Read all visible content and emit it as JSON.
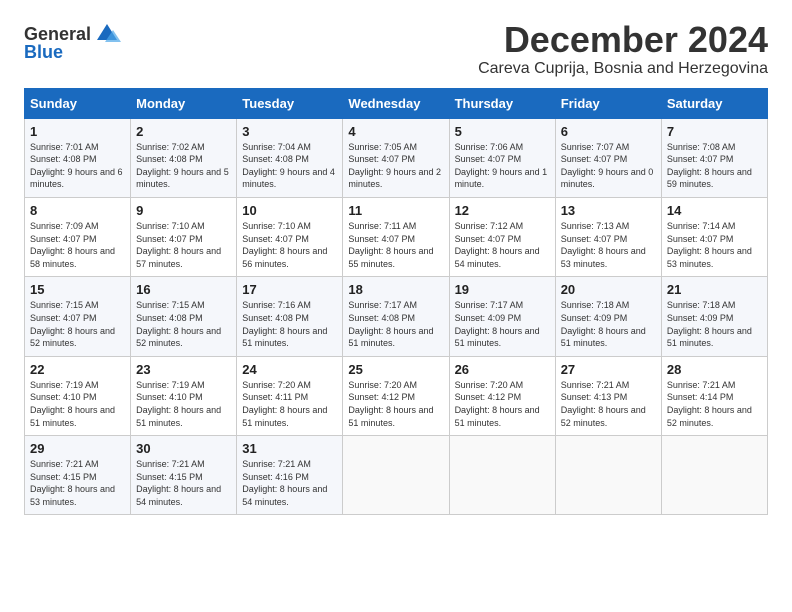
{
  "logo": {
    "general": "General",
    "blue": "Blue"
  },
  "title": "December 2024",
  "subtitle": "Careva Cuprija, Bosnia and Herzegovina",
  "days_header": [
    "Sunday",
    "Monday",
    "Tuesday",
    "Wednesday",
    "Thursday",
    "Friday",
    "Saturday"
  ],
  "weeks": [
    [
      {
        "day": "1",
        "sunrise": "Sunrise: 7:01 AM",
        "sunset": "Sunset: 4:08 PM",
        "daylight": "Daylight: 9 hours and 6 minutes."
      },
      {
        "day": "2",
        "sunrise": "Sunrise: 7:02 AM",
        "sunset": "Sunset: 4:08 PM",
        "daylight": "Daylight: 9 hours and 5 minutes."
      },
      {
        "day": "3",
        "sunrise": "Sunrise: 7:04 AM",
        "sunset": "Sunset: 4:08 PM",
        "daylight": "Daylight: 9 hours and 4 minutes."
      },
      {
        "day": "4",
        "sunrise": "Sunrise: 7:05 AM",
        "sunset": "Sunset: 4:07 PM",
        "daylight": "Daylight: 9 hours and 2 minutes."
      },
      {
        "day": "5",
        "sunrise": "Sunrise: 7:06 AM",
        "sunset": "Sunset: 4:07 PM",
        "daylight": "Daylight: 9 hours and 1 minute."
      },
      {
        "day": "6",
        "sunrise": "Sunrise: 7:07 AM",
        "sunset": "Sunset: 4:07 PM",
        "daylight": "Daylight: 9 hours and 0 minutes."
      },
      {
        "day": "7",
        "sunrise": "Sunrise: 7:08 AM",
        "sunset": "Sunset: 4:07 PM",
        "daylight": "Daylight: 8 hours and 59 minutes."
      }
    ],
    [
      {
        "day": "8",
        "sunrise": "Sunrise: 7:09 AM",
        "sunset": "Sunset: 4:07 PM",
        "daylight": "Daylight: 8 hours and 58 minutes."
      },
      {
        "day": "9",
        "sunrise": "Sunrise: 7:10 AM",
        "sunset": "Sunset: 4:07 PM",
        "daylight": "Daylight: 8 hours and 57 minutes."
      },
      {
        "day": "10",
        "sunrise": "Sunrise: 7:10 AM",
        "sunset": "Sunset: 4:07 PM",
        "daylight": "Daylight: 8 hours and 56 minutes."
      },
      {
        "day": "11",
        "sunrise": "Sunrise: 7:11 AM",
        "sunset": "Sunset: 4:07 PM",
        "daylight": "Daylight: 8 hours and 55 minutes."
      },
      {
        "day": "12",
        "sunrise": "Sunrise: 7:12 AM",
        "sunset": "Sunset: 4:07 PM",
        "daylight": "Daylight: 8 hours and 54 minutes."
      },
      {
        "day": "13",
        "sunrise": "Sunrise: 7:13 AM",
        "sunset": "Sunset: 4:07 PM",
        "daylight": "Daylight: 8 hours and 53 minutes."
      },
      {
        "day": "14",
        "sunrise": "Sunrise: 7:14 AM",
        "sunset": "Sunset: 4:07 PM",
        "daylight": "Daylight: 8 hours and 53 minutes."
      }
    ],
    [
      {
        "day": "15",
        "sunrise": "Sunrise: 7:15 AM",
        "sunset": "Sunset: 4:07 PM",
        "daylight": "Daylight: 8 hours and 52 minutes."
      },
      {
        "day": "16",
        "sunrise": "Sunrise: 7:15 AM",
        "sunset": "Sunset: 4:08 PM",
        "daylight": "Daylight: 8 hours and 52 minutes."
      },
      {
        "day": "17",
        "sunrise": "Sunrise: 7:16 AM",
        "sunset": "Sunset: 4:08 PM",
        "daylight": "Daylight: 8 hours and 51 minutes."
      },
      {
        "day": "18",
        "sunrise": "Sunrise: 7:17 AM",
        "sunset": "Sunset: 4:08 PM",
        "daylight": "Daylight: 8 hours and 51 minutes."
      },
      {
        "day": "19",
        "sunrise": "Sunrise: 7:17 AM",
        "sunset": "Sunset: 4:09 PM",
        "daylight": "Daylight: 8 hours and 51 minutes."
      },
      {
        "day": "20",
        "sunrise": "Sunrise: 7:18 AM",
        "sunset": "Sunset: 4:09 PM",
        "daylight": "Daylight: 8 hours and 51 minutes."
      },
      {
        "day": "21",
        "sunrise": "Sunrise: 7:18 AM",
        "sunset": "Sunset: 4:09 PM",
        "daylight": "Daylight: 8 hours and 51 minutes."
      }
    ],
    [
      {
        "day": "22",
        "sunrise": "Sunrise: 7:19 AM",
        "sunset": "Sunset: 4:10 PM",
        "daylight": "Daylight: 8 hours and 51 minutes."
      },
      {
        "day": "23",
        "sunrise": "Sunrise: 7:19 AM",
        "sunset": "Sunset: 4:10 PM",
        "daylight": "Daylight: 8 hours and 51 minutes."
      },
      {
        "day": "24",
        "sunrise": "Sunrise: 7:20 AM",
        "sunset": "Sunset: 4:11 PM",
        "daylight": "Daylight: 8 hours and 51 minutes."
      },
      {
        "day": "25",
        "sunrise": "Sunrise: 7:20 AM",
        "sunset": "Sunset: 4:12 PM",
        "daylight": "Daylight: 8 hours and 51 minutes."
      },
      {
        "day": "26",
        "sunrise": "Sunrise: 7:20 AM",
        "sunset": "Sunset: 4:12 PM",
        "daylight": "Daylight: 8 hours and 51 minutes."
      },
      {
        "day": "27",
        "sunrise": "Sunrise: 7:21 AM",
        "sunset": "Sunset: 4:13 PM",
        "daylight": "Daylight: 8 hours and 52 minutes."
      },
      {
        "day": "28",
        "sunrise": "Sunrise: 7:21 AM",
        "sunset": "Sunset: 4:14 PM",
        "daylight": "Daylight: 8 hours and 52 minutes."
      }
    ],
    [
      {
        "day": "29",
        "sunrise": "Sunrise: 7:21 AM",
        "sunset": "Sunset: 4:15 PM",
        "daylight": "Daylight: 8 hours and 53 minutes."
      },
      {
        "day": "30",
        "sunrise": "Sunrise: 7:21 AM",
        "sunset": "Sunset: 4:15 PM",
        "daylight": "Daylight: 8 hours and 54 minutes."
      },
      {
        "day": "31",
        "sunrise": "Sunrise: 7:21 AM",
        "sunset": "Sunset: 4:16 PM",
        "daylight": "Daylight: 8 hours and 54 minutes."
      },
      null,
      null,
      null,
      null
    ]
  ]
}
